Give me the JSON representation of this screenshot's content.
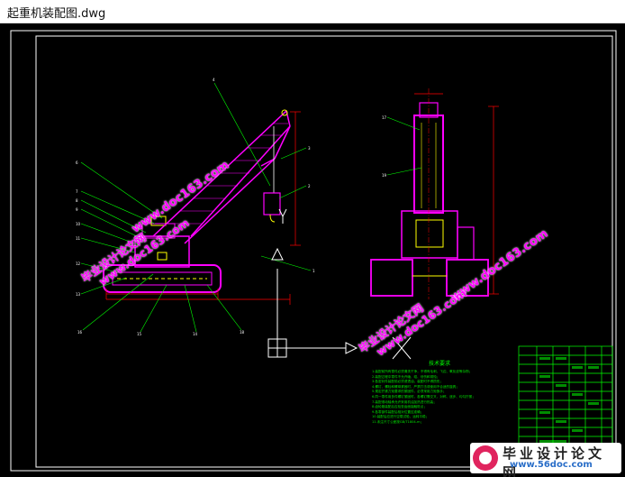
{
  "window": {
    "title": "起重机装配图.dwg"
  },
  "drawing": {
    "notes_heading": "技术要求",
    "notes_lines": [
      "1.装配前所有零件必须清洗干净，不得有毛刺、飞边、氧化皮等杂物；",
      "2.装配过程中零件不允许磕、碰、划伤和锈蚀；",
      "3.各密封件装配前必须浸透油，装配时不得损伤；",
      "4.螺钉、螺栓和螺母紧固时，严禁打击或使用不合适的旋具；",
      "5.规定拧紧力矩要求的紧固件，必须采用力矩扳手；",
      "6.同一零件用多件螺钉紧固时，各螺钉需交叉、对称、逐步、均匀拧紧；",
      "7.装配滚动轴承允许采用机油加热进行热装；",
      "8.齿轮箱装配后应检查齿面接触斑点；",
      "9.各零部件装配后相对位置应准确；",
      "10.装配后应进行空载试验，运转平稳；",
      "11.未注尺寸公差按GB/T1804-m；"
    ],
    "colors": {
      "background": "#000000",
      "frame": "#ffffff",
      "outline": "#ff00ff",
      "leader": "#00ff00",
      "dimension": "#ff0000",
      "title_block": "#00ff00",
      "watermark": "#ff00ff"
    }
  },
  "watermarks": [
    {
      "line1": "www.doc163.com",
      "line2": ""
    },
    {
      "line1": "毕业设计论文网",
      "line2": "www.doc163.com"
    },
    {
      "line1": "www.doc163.com",
      "line2": ""
    },
    {
      "line1": "毕业设计论文网",
      "line2": "www.doc163.com"
    }
  ],
  "logo": {
    "title": "毕业设计论文网",
    "url": "www.56doc.com"
  }
}
